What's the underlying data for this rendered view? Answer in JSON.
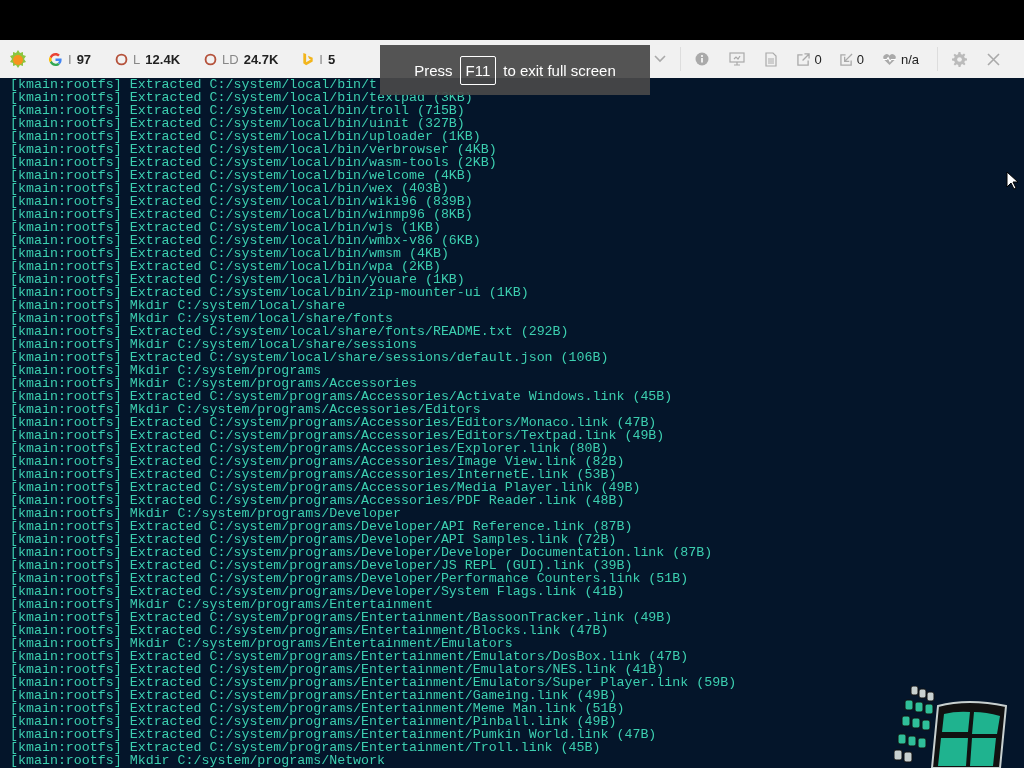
{
  "toolbar": {
    "metrics": [
      {
        "kind": "google",
        "label": "I",
        "value": "97"
      },
      {
        "kind": "ring",
        "label": "L",
        "value": "12.4K"
      },
      {
        "kind": "ring",
        "label": "LD",
        "value": "24.7K"
      },
      {
        "kind": "bing",
        "label": "I",
        "value": "5"
      }
    ],
    "stats": [
      {
        "kind": "external",
        "value": "0"
      },
      {
        "kind": "import",
        "value": "0"
      },
      {
        "kind": "health",
        "value": "n/a"
      }
    ]
  },
  "fullscreen_notice": {
    "before": "Press",
    "key": "F11",
    "after": "to exit full screen"
  },
  "terminal": {
    "lines": [
      "[kmain:rootfs] Extracted C:/system/local/bin/t",
      "[kmain:rootfs] Extracted C:/system/local/bin/textpad (3KB)",
      "[kmain:rootfs] Extracted C:/system/local/bin/troll (715B)",
      "[kmain:rootfs] Extracted C:/system/local/bin/uinit (327B)",
      "[kmain:rootfs] Extracted C:/system/local/bin/uploader (1KB)",
      "[kmain:rootfs] Extracted C:/system/local/bin/verbrowser (4KB)",
      "[kmain:rootfs] Extracted C:/system/local/bin/wasm-tools (2KB)",
      "[kmain:rootfs] Extracted C:/system/local/bin/welcome (4KB)",
      "[kmain:rootfs] Extracted C:/system/local/bin/wex (403B)",
      "[kmain:rootfs] Extracted C:/system/local/bin/wiki96 (839B)",
      "[kmain:rootfs] Extracted C:/system/local/bin/winmp96 (8KB)",
      "[kmain:rootfs] Extracted C:/system/local/bin/wjs (1KB)",
      "[kmain:rootfs] Extracted C:/system/local/bin/wmbx-v86 (6KB)",
      "[kmain:rootfs] Extracted C:/system/local/bin/wmsm (4KB)",
      "[kmain:rootfs] Extracted C:/system/local/bin/wpa (2KB)",
      "[kmain:rootfs] Extracted C:/system/local/bin/youare (1KB)",
      "[kmain:rootfs] Extracted C:/system/local/bin/zip-mounter-ui (1KB)",
      "[kmain:rootfs] Mkdir C:/system/local/share",
      "[kmain:rootfs] Mkdir C:/system/local/share/fonts",
      "[kmain:rootfs] Extracted C:/system/local/share/fonts/README.txt (292B)",
      "[kmain:rootfs] Mkdir C:/system/local/share/sessions",
      "[kmain:rootfs] Extracted C:/system/local/share/sessions/default.json (106B)",
      "[kmain:rootfs] Mkdir C:/system/programs",
      "[kmain:rootfs] Mkdir C:/system/programs/Accessories",
      "[kmain:rootfs] Extracted C:/system/programs/Accessories/Activate Windows.link (45B)",
      "[kmain:rootfs] Mkdir C:/system/programs/Accessories/Editors",
      "[kmain:rootfs] Extracted C:/system/programs/Accessories/Editors/Monaco.link (47B)",
      "[kmain:rootfs] Extracted C:/system/programs/Accessories/Editors/Textpad.link (49B)",
      "[kmain:rootfs] Extracted C:/system/programs/Accessories/Explorer.link (80B)",
      "[kmain:rootfs] Extracted C:/system/programs/Accessories/Image View.link (82B)",
      "[kmain:rootfs] Extracted C:/system/programs/Accessories/InternetE.link (53B)",
      "[kmain:rootfs] Extracted C:/system/programs/Accessories/Media Player.link (49B)",
      "[kmain:rootfs] Extracted C:/system/programs/Accessories/PDF Reader.link (48B)",
      "[kmain:rootfs] Mkdir C:/system/programs/Developer",
      "[kmain:rootfs] Extracted C:/system/programs/Developer/API Reference.link (87B)",
      "[kmain:rootfs] Extracted C:/system/programs/Developer/API Samples.link (72B)",
      "[kmain:rootfs] Extracted C:/system/programs/Developer/Developer Documentation.link (87B)",
      "[kmain:rootfs] Extracted C:/system/programs/Developer/JS REPL (GUI).link (39B)",
      "[kmain:rootfs] Extracted C:/system/programs/Developer/Performance Counters.link (51B)",
      "[kmain:rootfs] Extracted C:/system/programs/Developer/System Flags.link (41B)",
      "[kmain:rootfs] Mkdir C:/system/programs/Entertainment",
      "[kmain:rootfs] Extracted C:/system/programs/Entertainment/BassoonTracker.link (49B)",
      "[kmain:rootfs] Extracted C:/system/programs/Entertainment/Blocks.link (47B)",
      "[kmain:rootfs] Mkdir C:/system/programs/Entertainment/Emulators",
      "[kmain:rootfs] Extracted C:/system/programs/Entertainment/Emulators/DosBox.link (47B)",
      "[kmain:rootfs] Extracted C:/system/programs/Entertainment/Emulators/NES.link (41B)",
      "[kmain:rootfs] Extracted C:/system/programs/Entertainment/Emulators/Super Player.link (59B)",
      "[kmain:rootfs] Extracted C:/system/programs/Entertainment/Gameing.link (49B)",
      "[kmain:rootfs] Extracted C:/system/programs/Entertainment/Meme Man.link (51B)",
      "[kmain:rootfs] Extracted C:/system/programs/Entertainment/Pinball.link (49B)",
      "[kmain:rootfs] Extracted C:/system/programs/Entertainment/Pumkin World.link (47B)",
      "[kmain:rootfs] Extracted C:/system/programs/Entertainment/Troll.link (45B)",
      "[kmain:rootfs] Mkdir C:/system/programs/Network"
    ]
  }
}
